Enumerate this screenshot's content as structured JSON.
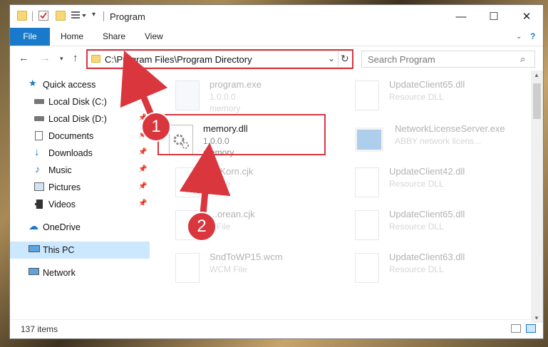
{
  "window": {
    "title": "Program"
  },
  "controls": {
    "minimize": "—",
    "maximize": "☐",
    "close": "✕"
  },
  "ribbon": {
    "tabs": [
      "File",
      "Home",
      "Share",
      "View"
    ]
  },
  "address": {
    "path": "C:\\Program Files\\Program Directory"
  },
  "search": {
    "placeholder": "Search Program"
  },
  "sidebar": {
    "items": [
      {
        "label": "Quick access",
        "icon": "star-icon",
        "pinned": false
      },
      {
        "label": "Local Disk (C:)",
        "icon": "drive-icon",
        "pinned": true
      },
      {
        "label": "Local Disk (D:)",
        "icon": "drive-icon",
        "pinned": true
      },
      {
        "label": "Documents",
        "icon": "documents-icon",
        "pinned": true
      },
      {
        "label": "Downloads",
        "icon": "downloads-icon",
        "pinned": true
      },
      {
        "label": "Music",
        "icon": "music-icon",
        "pinned": true
      },
      {
        "label": "Pictures",
        "icon": "pictures-icon",
        "pinned": true
      },
      {
        "label": "Videos",
        "icon": "videos-icon",
        "pinned": true
      },
      {
        "label": "OneDrive",
        "icon": "cloud-icon",
        "pinned": false
      },
      {
        "label": "This PC",
        "icon": "computer-icon",
        "pinned": false
      },
      {
        "label": "Network",
        "icon": "network-icon",
        "pinned": false
      }
    ]
  },
  "files": {
    "left": [
      {
        "name": "program.exe",
        "line1": "1.0.0.0",
        "line2": "memory"
      },
      {
        "name": "memory.dll",
        "line1": "1.0.0.0",
        "line2": "memory"
      },
      {
        "name": "...tKorn.cjk",
        "line1": "...File",
        "line2": ""
      },
      {
        "name": "...orean.cjk",
        "line1": "...File",
        "line2": ""
      },
      {
        "name": "SndToWP15.wcm",
        "line1": "WCM File",
        "line2": ""
      }
    ],
    "right": [
      {
        "name": "UpdateClient65.dll",
        "line1": "Resource DLL",
        "line2": ""
      },
      {
        "name": "NetworkLicenseServer.exe",
        "line1": "ABBY network licens...",
        "line2": ""
      },
      {
        "name": "UpdateClient42.dll",
        "line1": "Resource DLL",
        "line2": ""
      },
      {
        "name": "UpdateClient65.dll",
        "line1": "Resource DLL",
        "line2": ""
      },
      {
        "name": "UpdateClient63.dll",
        "line1": "Resource DLL",
        "line2": ""
      }
    ]
  },
  "status": {
    "items": "137 items"
  },
  "annotations": {
    "step1": "1",
    "step2": "2",
    "color": "#d9363e"
  }
}
